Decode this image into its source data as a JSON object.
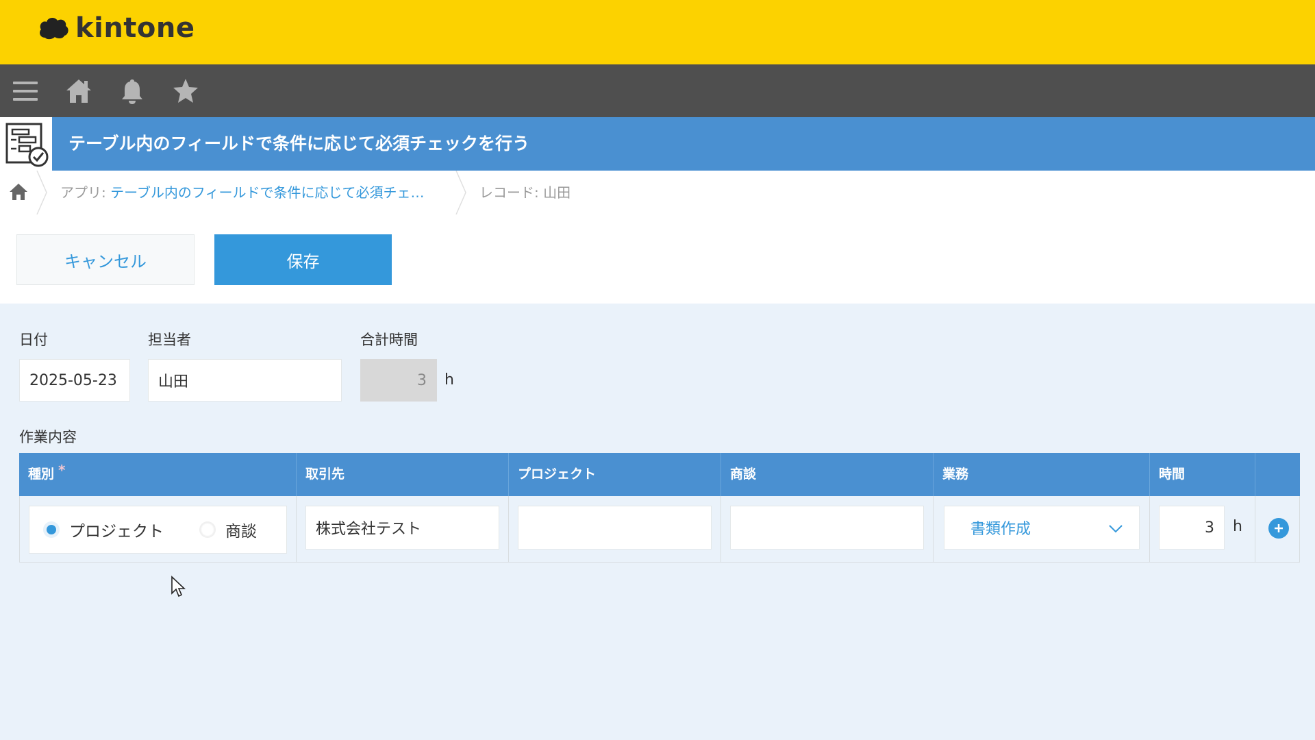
{
  "header": {
    "logo_text": "kintone"
  },
  "nav": {
    "icons": [
      "menu-icon",
      "home-icon",
      "bell-icon",
      "star-icon"
    ]
  },
  "app": {
    "title": "テーブル内のフィールドで条件に応じて必須チェックを行う"
  },
  "breadcrumb": {
    "app_prefix": "アプリ: ",
    "app_name": "テーブル内のフィールドで条件に応じて必須チェ…",
    "record": "レコード: 山田"
  },
  "toolbar": {
    "cancel_label": "キャンセル",
    "save_label": "保存"
  },
  "fields": {
    "date": {
      "label": "日付",
      "value": "2025-05-23"
    },
    "assignee": {
      "label": "担当者",
      "value": "山田"
    },
    "total_hours": {
      "label": "合計時間",
      "value": "3",
      "unit": "h"
    }
  },
  "table": {
    "label": "作業内容",
    "headers": {
      "type": "種別",
      "required_mark": "*",
      "client": "取引先",
      "project": "プロジェクト",
      "deal": "商談",
      "task": "業務",
      "hours": "時間"
    },
    "row": {
      "type_options": [
        "プロジェクト",
        "商談"
      ],
      "type_selected": "プロジェクト",
      "client": "株式会社テスト",
      "project": "",
      "deal": "",
      "task": "書類作成",
      "hours": "3",
      "hours_unit": "h"
    }
  },
  "colors": {
    "brand_yellow": "#fcd200",
    "nav_gray": "#4f4f4f",
    "header_blue": "#4a90d1",
    "accent_blue": "#3498db",
    "background": "#eaf2fa"
  }
}
